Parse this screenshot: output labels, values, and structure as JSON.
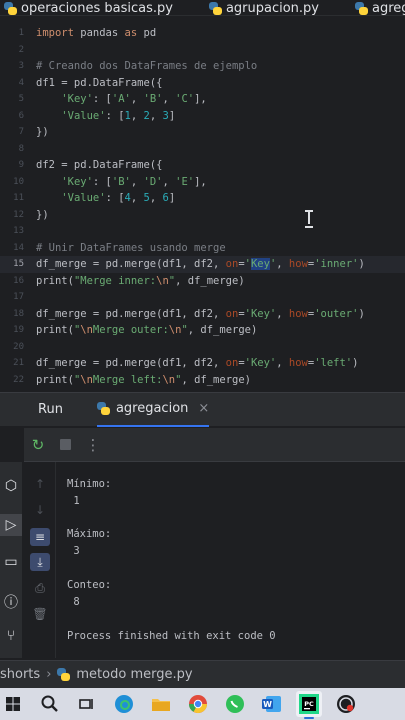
{
  "editor_tabs": [
    {
      "label": "operaciones basicas.py"
    },
    {
      "label": "agrupacion.py"
    },
    {
      "label": "agregacion"
    }
  ],
  "editor": {
    "current_line": 15,
    "lines": [
      {
        "num": "1"
      },
      {
        "num": "2"
      },
      {
        "num": "3"
      },
      {
        "num": "4"
      },
      {
        "num": "5"
      },
      {
        "num": "6"
      },
      {
        "num": "7"
      },
      {
        "num": "8"
      },
      {
        "num": "9"
      },
      {
        "num": "10"
      },
      {
        "num": "11"
      },
      {
        "num": "12"
      },
      {
        "num": "13"
      },
      {
        "num": "14"
      },
      {
        "num": "15"
      },
      {
        "num": "16"
      },
      {
        "num": "17"
      },
      {
        "num": "18"
      },
      {
        "num": "19"
      },
      {
        "num": "20"
      },
      {
        "num": "21"
      },
      {
        "num": "22"
      }
    ],
    "code": {
      "l1_kw1": "import",
      "l1_mid": " pandas ",
      "l1_kw2": "as",
      "l1_end": " pd",
      "l3": "# Creando dos DataFrames de ejemplo",
      "l4": "df1 = pd.DataFrame({",
      "l5_a": "    ",
      "l5_key": "'Key'",
      "l5_b": ": [",
      "l5_s1": "'A'",
      "l5_c1": ", ",
      "l5_s2": "'B'",
      "l5_c2": ", ",
      "l5_s3": "'C'",
      "l5_e": "],",
      "l6_a": "    ",
      "l6_key": "'Value'",
      "l6_b": ": [",
      "l6_n1": "1",
      "l6_c1": ", ",
      "l6_n2": "2",
      "l6_c2": ", ",
      "l6_n3": "3",
      "l6_e": "]",
      "l7": "})",
      "l9": "df2 = pd.DataFrame({",
      "l10_a": "    ",
      "l10_key": "'Key'",
      "l10_b": ": [",
      "l10_s1": "'B'",
      "l10_c1": ", ",
      "l10_s2": "'D'",
      "l10_c2": ", ",
      "l10_s3": "'E'",
      "l10_e": "],",
      "l11_a": "    ",
      "l11_key": "'Value'",
      "l11_b": ": [",
      "l11_n1": "4",
      "l11_c1": ", ",
      "l11_n2": "5",
      "l11_c2": ", ",
      "l11_n3": "6",
      "l11_e": "]",
      "l12": "})",
      "l14": "# Unir DataFrames usando merge",
      "l15_a": "df_merge = pd.merge(df1, df2, ",
      "l15_p1": "on",
      "l15_eq1": "=",
      "l15_q1": "'",
      "l15_key": "Key",
      "l15_q2": "'",
      "l15_c": ", ",
      "l15_p2": "how",
      "l15_eq2": "=",
      "l15_s2": "'inner'",
      "l15_e": ")",
      "l16_a": "print(",
      "l16_s1": "\"Merge inner:",
      "l16_esc": "\\n",
      "l16_s2": "\"",
      "l16_e": ", df_merge)",
      "l18_a": "df_merge = pd.merge(df1, df2, ",
      "l18_p1": "on",
      "l18_eq1": "=",
      "l18_s1": "'Key'",
      "l18_c": ", ",
      "l18_p2": "how",
      "l18_eq2": "=",
      "l18_s2": "'outer'",
      "l18_e": ")",
      "l19_a": "print(",
      "l19_s0": "\"",
      "l19_esc1": "\\n",
      "l19_s1": "Merge outer:",
      "l19_esc2": "\\n",
      "l19_s2": "\"",
      "l19_e": ", df_merge)",
      "l21_a": "df_merge = pd.merge(df1, df2, ",
      "l21_p1": "on",
      "l21_eq1": "=",
      "l21_s1": "'Key'",
      "l21_c": ", ",
      "l21_p2": "how",
      "l21_eq2": "=",
      "l21_s2": "'left'",
      "l21_e": ")",
      "l22_a": "print(",
      "l22_s0": "\"",
      "l22_esc1": "\\n",
      "l22_s1": "Merge left:",
      "l22_esc2": "\\n",
      "l22_s2": "\"",
      "l22_e": ", df_merge)"
    }
  },
  "run_panel": {
    "title": "Run",
    "tab_label": "agregacion",
    "close": "×",
    "output": [
      "Mínimo:",
      " 1",
      "",
      "Máximo:",
      " 3",
      "",
      "Conteo:",
      " 8",
      "",
      "Process finished with exit code 0"
    ]
  },
  "breadcrumb": {
    "folder": "shorts",
    "separator": "›",
    "file": "metodo merge.py"
  },
  "colors": {
    "editor_bg": "#1e1f22",
    "panel_bg": "#2b2d30",
    "keyword": "#cf8e6d",
    "string": "#6aab73",
    "number": "#2aacb8",
    "comment": "#7a7e85",
    "accent": "#3574f0"
  }
}
